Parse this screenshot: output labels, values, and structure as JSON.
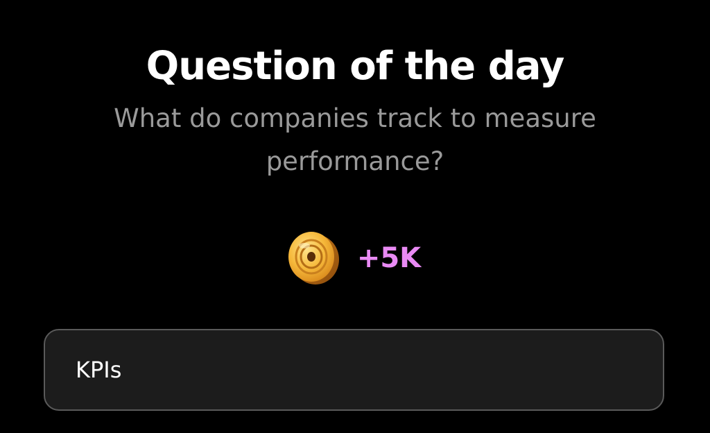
{
  "header": {
    "title": "Question of the day",
    "question": "What do companies track to measure performance?"
  },
  "reward": {
    "icon": "coin-icon",
    "amount": "+5K",
    "accent_color": "#e98af4"
  },
  "answer": {
    "value": "KPIs"
  }
}
